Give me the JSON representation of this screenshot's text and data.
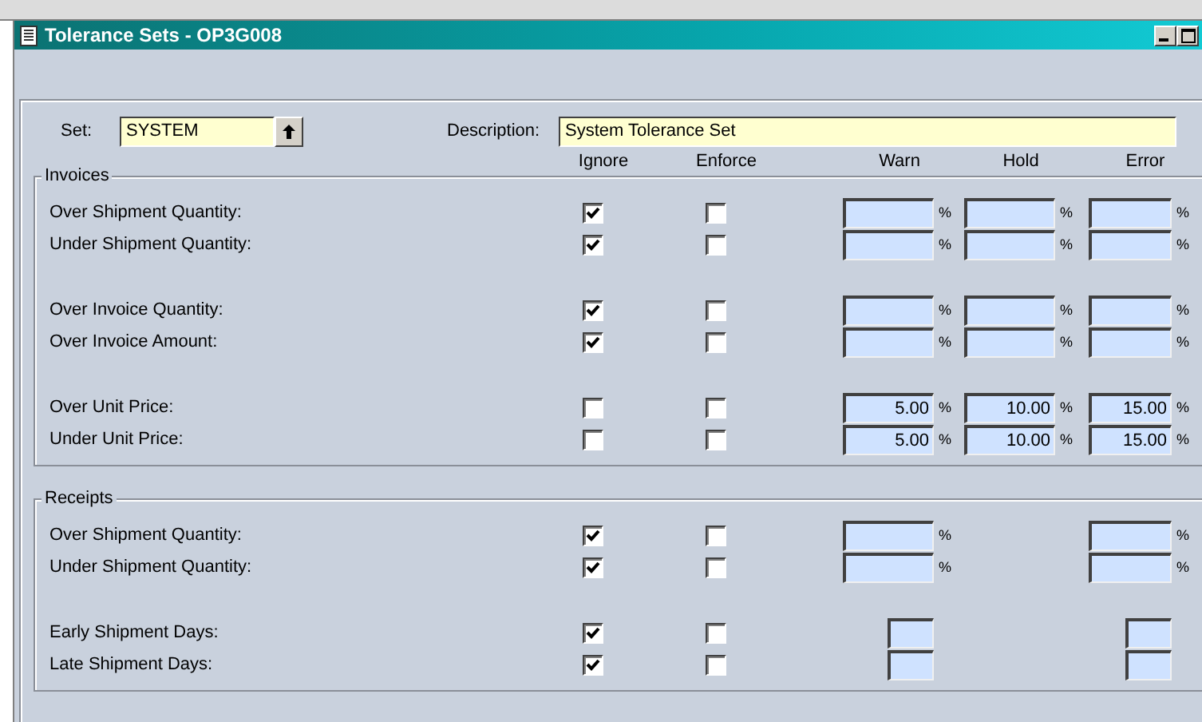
{
  "window": {
    "title": "Tolerance Sets - OP3G008"
  },
  "set": {
    "label": "Set:",
    "value": "SYSTEM"
  },
  "description": {
    "label": "Description:",
    "value": "System Tolerance Set"
  },
  "columns": [
    {
      "label": "Ignore"
    },
    {
      "label": "Enforce"
    },
    {
      "label": "Warn"
    },
    {
      "label": "Hold"
    },
    {
      "label": "Error"
    }
  ],
  "sections": [
    {
      "title": "Invoices",
      "groups": [
        {
          "rows": [
            {
              "label": "Over Shipment Quantity:",
              "ignore": true,
              "enforce": false,
              "warn": {
                "kind": "percent",
                "unit": "%"
              },
              "hold": {
                "kind": "percent",
                "unit": "%"
              },
              "error": {
                "kind": "percent",
                "unit": "%"
              }
            },
            {
              "label": "Under Shipment Quantity:",
              "ignore": true,
              "enforce": false,
              "warn": {
                "kind": "percent",
                "unit": "%"
              },
              "hold": {
                "kind": "percent",
                "unit": "%"
              },
              "error": {
                "kind": "percent",
                "unit": "%"
              }
            }
          ]
        },
        {
          "rows": [
            {
              "label": "Over Invoice Quantity:",
              "ignore": true,
              "enforce": false,
              "warn": {
                "kind": "percent",
                "unit": "%"
              },
              "hold": {
                "kind": "percent",
                "unit": "%"
              },
              "error": {
                "kind": "percent",
                "unit": "%"
              }
            },
            {
              "label": "Over Invoice Amount:",
              "ignore": true,
              "enforce": false,
              "warn": {
                "kind": "percent",
                "unit": "%"
              },
              "hold": {
                "kind": "percent",
                "unit": "%"
              },
              "error": {
                "kind": "percent",
                "unit": "%"
              }
            }
          ]
        },
        {
          "rows": [
            {
              "label": "Over Unit Price:",
              "ignore": false,
              "enforce": false,
              "warn": {
                "kind": "percent",
                "value": "5.00",
                "unit": "%"
              },
              "hold": {
                "kind": "percent",
                "value": "10.00",
                "unit": "%"
              },
              "error": {
                "kind": "percent",
                "value": "15.00",
                "unit": "%"
              }
            },
            {
              "label": "Under Unit Price:",
              "ignore": false,
              "enforce": false,
              "warn": {
                "kind": "percent",
                "value": "5.00",
                "unit": "%"
              },
              "hold": {
                "kind": "percent",
                "value": "10.00",
                "unit": "%"
              },
              "error": {
                "kind": "percent",
                "value": "15.00",
                "unit": "%"
              }
            }
          ]
        }
      ]
    },
    {
      "title": "Receipts",
      "groups": [
        {
          "rows": [
            {
              "label": "Over Shipment Quantity:",
              "ignore": true,
              "enforce": false,
              "warn": {
                "kind": "percent",
                "unit": "%"
              },
              "error": {
                "kind": "percent",
                "unit": "%"
              }
            },
            {
              "label": "Under Shipment Quantity:",
              "ignore": true,
              "enforce": false,
              "warn": {
                "kind": "percent",
                "unit": "%"
              },
              "error": {
                "kind": "percent",
                "unit": "%"
              }
            }
          ]
        },
        {
          "rows": [
            {
              "label": "Early Shipment Days:",
              "ignore": true,
              "enforce": false,
              "warn": {
                "kind": "days"
              },
              "error": {
                "kind": "days"
              }
            },
            {
              "label": "Late Shipment Days:",
              "ignore": true,
              "enforce": false,
              "warn": {
                "kind": "days"
              },
              "error": {
                "kind": "days"
              }
            }
          ]
        }
      ]
    }
  ]
}
